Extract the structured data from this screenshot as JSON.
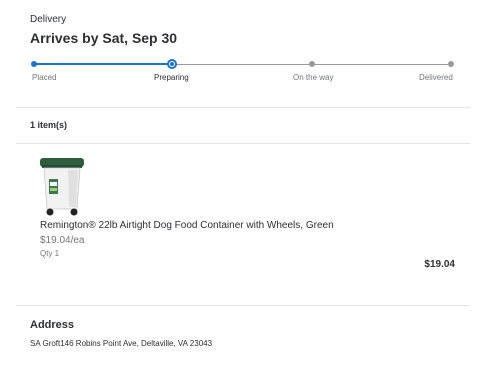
{
  "header": {
    "delivery_label": "Delivery",
    "arrives_text": "Arrives by Sat, Sep 30"
  },
  "tracker": {
    "steps": [
      {
        "label": "Placed",
        "state": "done"
      },
      {
        "label": "Preparing",
        "state": "current"
      },
      {
        "label": "On the way",
        "state": "pending"
      },
      {
        "label": "Delivered",
        "state": "pending"
      }
    ],
    "accent_color": "#1a75cf",
    "pending_color": "#999999"
  },
  "order": {
    "items_count": "1 item(s)",
    "items": [
      {
        "title": "Remington® 22lb Airtight Dog Food Container with Wheels, Green",
        "unit_price": "$19.04/ea",
        "qty": "Qty 1",
        "line_total": "$19.04",
        "image_icon": "pet-food-container-icon"
      }
    ]
  },
  "address": {
    "heading": "Address",
    "text": "SA Groft146 Robins Point Ave, Deltaville, VA 23043"
  }
}
